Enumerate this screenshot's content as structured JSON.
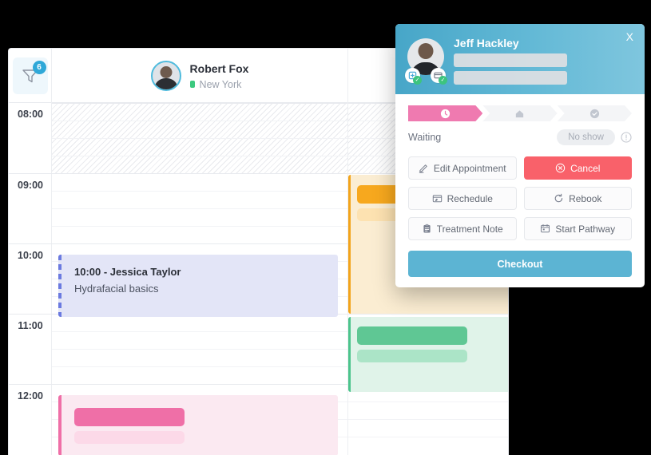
{
  "calendar": {
    "filter": {
      "icon": "funnel-icon",
      "badge_count": "6"
    },
    "columns": [
      {
        "name": "Robert Fox",
        "location": "New York",
        "status_color": "#3cc97f"
      },
      {
        "name": "",
        "location": ""
      }
    ],
    "time_labels": [
      "08:00",
      "09:00",
      "10:00",
      "11:00",
      "12:00"
    ],
    "events": [
      {
        "id": "ev-jessica",
        "column": 1,
        "title": "10:00 - Jessica Taylor",
        "subtitle": "Hydrafacial basics",
        "bg": "#e3e5f7",
        "accent": "#6b7ae0"
      },
      {
        "id": "ev-orange",
        "column": 2,
        "title": "",
        "subtitle": "",
        "bg": "#fbedd2",
        "accent": "#f2a41c"
      },
      {
        "id": "ev-green",
        "column": 2,
        "title": "",
        "subtitle": "",
        "bg": "#e0f3e9",
        "accent": "#4cc48c"
      },
      {
        "id": "ev-pink",
        "column": 1,
        "title": "",
        "subtitle": "",
        "bg": "#fbe9f1",
        "accent": "#ef6fa7"
      }
    ]
  },
  "popup": {
    "close_label": "X",
    "patient_name": "Jeff Hackley",
    "avatar_badges": [
      "treatment-verified-icon",
      "payment-verified-icon"
    ],
    "steps": [
      {
        "id": "waiting",
        "icon": "clock-icon",
        "active": true
      },
      {
        "id": "in-room",
        "icon": "home-icon",
        "active": false
      },
      {
        "id": "completed",
        "icon": "check-circle-icon",
        "active": false
      }
    ],
    "status_label": "Waiting",
    "no_show_label": "No show",
    "info_icon": "info-circle-icon",
    "actions": [
      {
        "label": "Edit Appointment",
        "icon": "pencil-icon",
        "style": "default"
      },
      {
        "label": "Cancel",
        "icon": "cancel-circle-icon",
        "style": "danger"
      },
      {
        "label": "Rechedule",
        "icon": "calendar-edit-icon",
        "style": "default"
      },
      {
        "label": "Rebook",
        "icon": "refresh-icon",
        "style": "default"
      },
      {
        "label": "Treatment Note",
        "icon": "clipboard-icon",
        "style": "default"
      },
      {
        "label": "Start Pathway",
        "icon": "calendar-icon",
        "style": "default"
      }
    ],
    "checkout_label": "Checkout",
    "colors": {
      "header_gradient_start": "#47a6c8",
      "header_gradient_end": "#7fc6de",
      "active_step": "#ef7ab0",
      "danger": "#f9616a",
      "checkout": "#5cb4d3"
    }
  }
}
